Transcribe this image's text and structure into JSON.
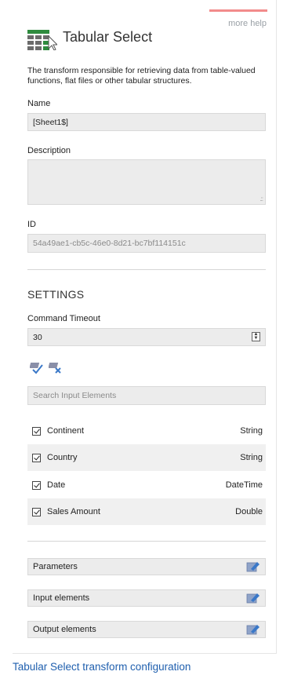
{
  "header": {
    "help_link": "more help",
    "title": "Tabular Select",
    "description": "The transform responsible for retrieving data from table-valued functions, flat files or other tabular structures."
  },
  "fields": {
    "name_label": "Name",
    "name_value": "[Sheet1$]",
    "description_label": "Description",
    "description_value": "",
    "id_label": "ID",
    "id_value": "54a49ae1-cb5c-46e0-8d21-bc7bf114151c"
  },
  "settings": {
    "title": "SETTINGS",
    "command_timeout_label": "Command Timeout",
    "command_timeout_value": "30",
    "search_placeholder": "Search Input Elements",
    "elements": [
      {
        "name": "Continent",
        "type": "String",
        "checked": true
      },
      {
        "name": "Country",
        "type": "String",
        "checked": true
      },
      {
        "name": "Date",
        "type": "DateTime",
        "checked": true
      },
      {
        "name": "Sales Amount",
        "type": "Double",
        "checked": true
      }
    ]
  },
  "sections": {
    "parameters": "Parameters",
    "input_elements": "Input elements",
    "output_elements": "Output elements"
  },
  "caption": "Tabular Select transform configuration",
  "colors": {
    "accent_bar": "#f28b8b",
    "caption_link": "#1f5fae",
    "logo_green": "#2e8b3e",
    "field_bg": "#ececec"
  },
  "icons": {
    "logo": "table-select-icon",
    "select_all": "check-all-icon",
    "clear_all": "uncheck-all-icon",
    "edit": "edit-pencil-icon"
  }
}
